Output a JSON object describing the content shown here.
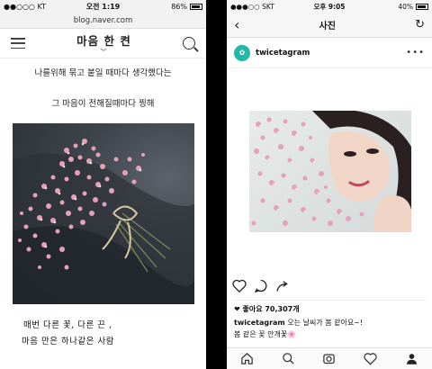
{
  "left_phone": {
    "status": {
      "carrier": "●●○○○ KT",
      "time": "오전 1:19",
      "battery": "86%"
    },
    "url": "blog.naver.com",
    "blog_title": "마음 한 켠",
    "lines": {
      "line1": "나를위해 묶고 붙일 때마다 생각했다는",
      "line2": "그 마음이 전해질때마다 찡해",
      "line3": "매번 다른 꽃, 다른 끈 ,",
      "line4": "마음 만은 하나같은  사람"
    }
  },
  "right_phone": {
    "status": {
      "carrier": "●●●○○ SKT",
      "time": "오후 9:05",
      "battery": "40%"
    },
    "nav_title": "사진",
    "username": "twicetagram",
    "likes": "좋아요 70,307개",
    "caption_user": "twicetagram",
    "caption_text": "오는 날씨가 봄 같아요~!",
    "caption_line2": "봄 같은 꽃 안개꽃🌸"
  },
  "colors": {
    "accent": "#22b8a6",
    "flower": "#e8a0b8"
  }
}
